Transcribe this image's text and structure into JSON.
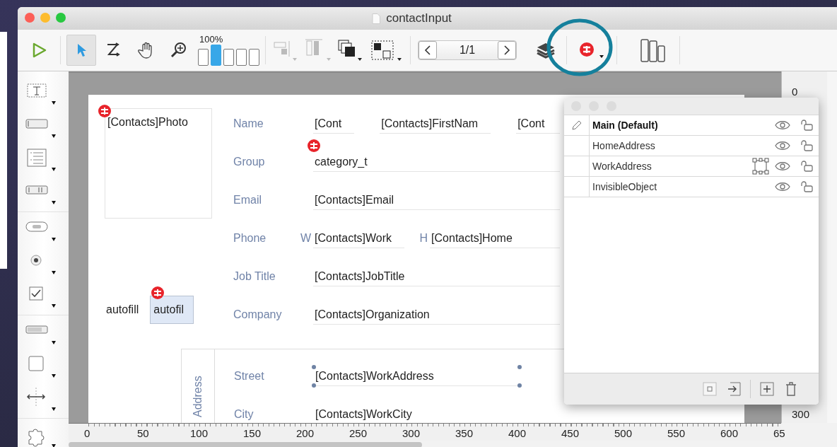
{
  "window": {
    "title": "contactInput"
  },
  "toolbar": {
    "tools": [
      {
        "kind": "run",
        "selected": false
      },
      {
        "kind": "pointer",
        "selected": true
      },
      {
        "kind": "order",
        "selected": false
      },
      {
        "kind": "hand",
        "selected": false
      },
      {
        "kind": "zoom",
        "selected": false
      }
    ],
    "zoom_label": "100%",
    "zoom_steps": [
      {
        "selected": false
      },
      {
        "selected": true
      },
      {
        "selected": false
      },
      {
        "selected": false
      },
      {
        "selected": false
      }
    ],
    "arrange": [
      {
        "kind": "align",
        "disabled": true
      },
      {
        "kind": "distribute",
        "disabled": true
      },
      {
        "kind": "stack",
        "disabled": false
      },
      {
        "kind": "group",
        "disabled": false
      }
    ],
    "page": "1/1"
  },
  "palette": {
    "groups": [
      [
        {
          "kind": "text"
        },
        {
          "kind": "input"
        },
        {
          "kind": "list"
        },
        {
          "kind": "header"
        }
      ],
      [
        {
          "kind": "button"
        },
        {
          "kind": "radio"
        },
        {
          "kind": "checkbox"
        }
      ],
      [
        {
          "kind": "progress"
        },
        {
          "kind": "rectangle"
        },
        {
          "kind": "splitter"
        }
      ],
      [
        {
          "kind": "plugin"
        }
      ]
    ]
  },
  "form": {
    "photo": {
      "value": "[Contacts]Photo",
      "badge": true
    },
    "rows": [
      {
        "label": "Name",
        "fields": [
          {
            "value": "[Cont",
            "badge": false
          },
          {
            "value": "[Contacts]FirstNam",
            "badge": false
          },
          {
            "value": "[Cont",
            "badge": false
          }
        ]
      },
      {
        "label": "Group",
        "fields": [
          {
            "value": "category_t",
            "badge": true
          }
        ]
      },
      {
        "label": "Email",
        "fields": [
          {
            "value": "[Contacts]Email",
            "badge": false
          }
        ]
      },
      {
        "label": "Phone",
        "fields": [
          {
            "prefix": "W",
            "value": "[Contacts]Work",
            "badge": false
          },
          {
            "prefix": "H",
            "value": "[Contacts]Home",
            "badge": false
          }
        ]
      },
      {
        "label": "Job Title",
        "fields": [
          {
            "value": "[Contacts]JobTitle",
            "badge": false
          }
        ]
      },
      {
        "label": "Company",
        "fields": [
          {
            "value": "[Contacts]Organization",
            "badge": false
          }
        ]
      }
    ],
    "autofill": {
      "label": "autofill",
      "value": "autofil",
      "badge": true
    },
    "address": {
      "title": "Address",
      "rows": [
        {
          "label": "Street",
          "value": "[Contacts]WorkAddress",
          "selected": true
        },
        {
          "label": "City",
          "value": "[Contacts]WorkCity",
          "selected": false
        }
      ]
    }
  },
  "rulers": {
    "horizontal": [
      "0",
      "50",
      "100",
      "150",
      "200",
      "250",
      "300",
      "350",
      "400",
      "450",
      "500",
      "550",
      "600",
      "65"
    ],
    "vertical": [
      "0",
      "300"
    ]
  },
  "layers_panel": {
    "layers": [
      {
        "name": "Main (Default)",
        "current": true,
        "has_selection": false
      },
      {
        "name": "HomeAddress",
        "current": false,
        "has_selection": false
      },
      {
        "name": "WorkAddress",
        "current": false,
        "has_selection": true
      },
      {
        "name": "InvisibleObject",
        "current": false,
        "has_selection": false
      }
    ]
  }
}
